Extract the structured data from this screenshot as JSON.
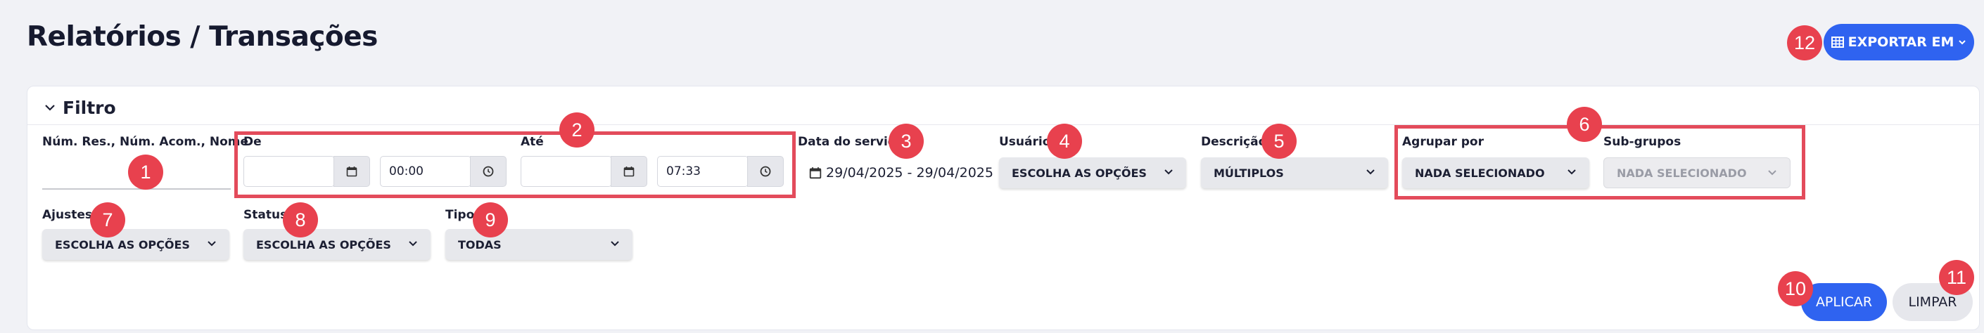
{
  "page": {
    "title": "Relatórios / Transações",
    "export_label": "EXPORTAR EM"
  },
  "filter": {
    "title": "Filtro",
    "fields": {
      "search": {
        "label": "Núm. Res., Núm. Acom., Nome",
        "value": ""
      },
      "de": {
        "label": "De",
        "date": "",
        "time": "00:00"
      },
      "ate": {
        "label": "Até",
        "date": "",
        "time": "07:33"
      },
      "data_servico": {
        "label": "Data do serviço",
        "value": "29/04/2025 - 29/04/2025"
      },
      "usuario": {
        "label": "Usuário",
        "value": "ESCOLHA AS OPÇÕES"
      },
      "descricao": {
        "label": "Descrição",
        "value": "MÚLTIPLOS"
      },
      "agrupar": {
        "label": "Agrupar por",
        "value": "NADA SELECIONADO"
      },
      "subgrupos": {
        "label": "Sub-grupos",
        "value": "NADA SELECIONADO"
      },
      "ajustes": {
        "label": "Ajustes",
        "value": "ESCOLHA AS OPÇÕES"
      },
      "status": {
        "label": "Status",
        "value": "ESCOLHA AS OPÇÕES"
      },
      "tipo": {
        "label": "Tipo",
        "value": "TODAS"
      }
    },
    "apply_label": "APLICAR",
    "clear_label": "LIMPAR"
  },
  "badges": [
    "1",
    "2",
    "3",
    "4",
    "5",
    "6",
    "7",
    "8",
    "9",
    "10",
    "11",
    "12"
  ],
  "colors": {
    "accent": "#2f63f0",
    "badge": "#e8414e",
    "highlight": "#e34b5b"
  },
  "icons": [
    "table-icon",
    "chevron-down-icon",
    "calendar-icon",
    "clock-icon"
  ]
}
